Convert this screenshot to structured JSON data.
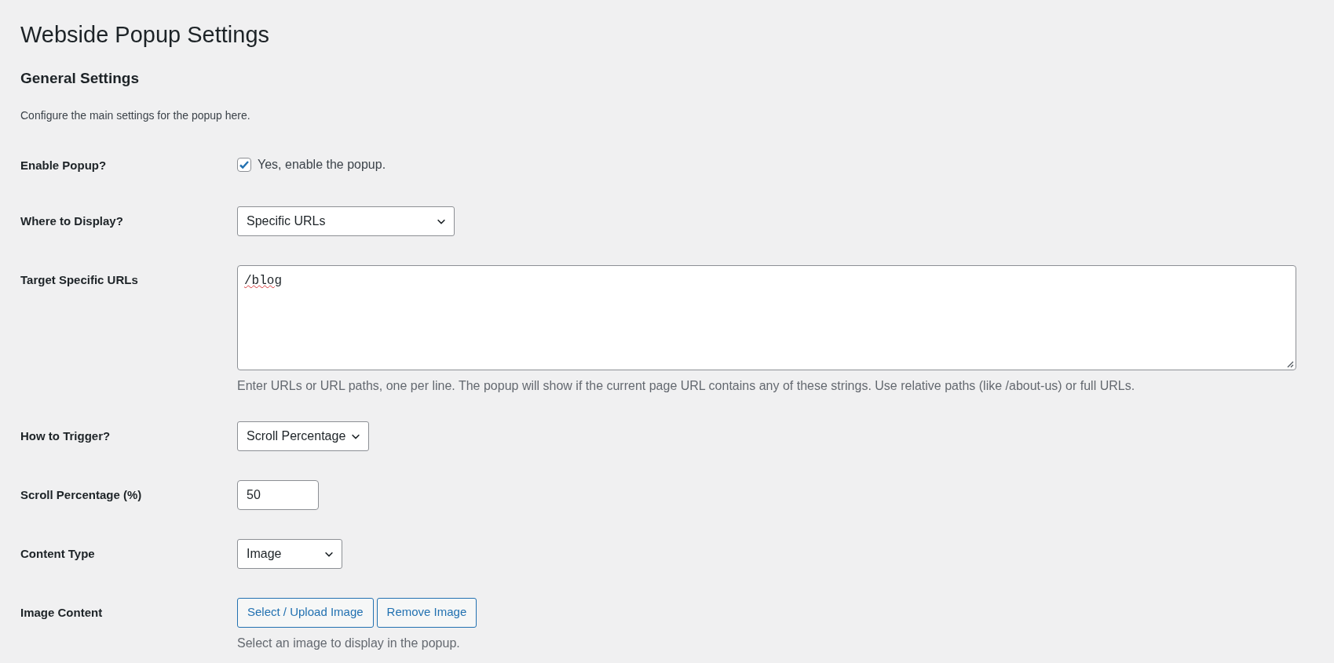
{
  "page_title": "Webside Popup Settings",
  "section": {
    "title": "General Settings",
    "description": "Configure the main settings for the popup here."
  },
  "fields": [
    {
      "kind": "checkbox",
      "label": "Enable Popup?",
      "checked": true,
      "text": "Yes, enable the popup."
    },
    {
      "kind": "select",
      "label": "Where to Display?",
      "value": "Specific URLs"
    },
    {
      "kind": "textarea",
      "label": "Target Specific URLs",
      "value": "/blog",
      "help": "Enter URLs or URL paths, one per line. The popup will show if the current page URL contains any of these strings. Use relative paths (like /about-us) or full URLs."
    },
    {
      "kind": "select",
      "label": "How to Trigger?",
      "value": "Scroll Percentage"
    },
    {
      "kind": "number",
      "label": "Scroll Percentage (%)",
      "value": "50"
    },
    {
      "kind": "select",
      "label": "Content Type",
      "value": "Image"
    },
    {
      "kind": "buttons",
      "label": "Image Content",
      "buttons": [
        "Select / Upload Image",
        "Remove Image"
      ],
      "help": "Select an image to display in the popup."
    }
  ]
}
